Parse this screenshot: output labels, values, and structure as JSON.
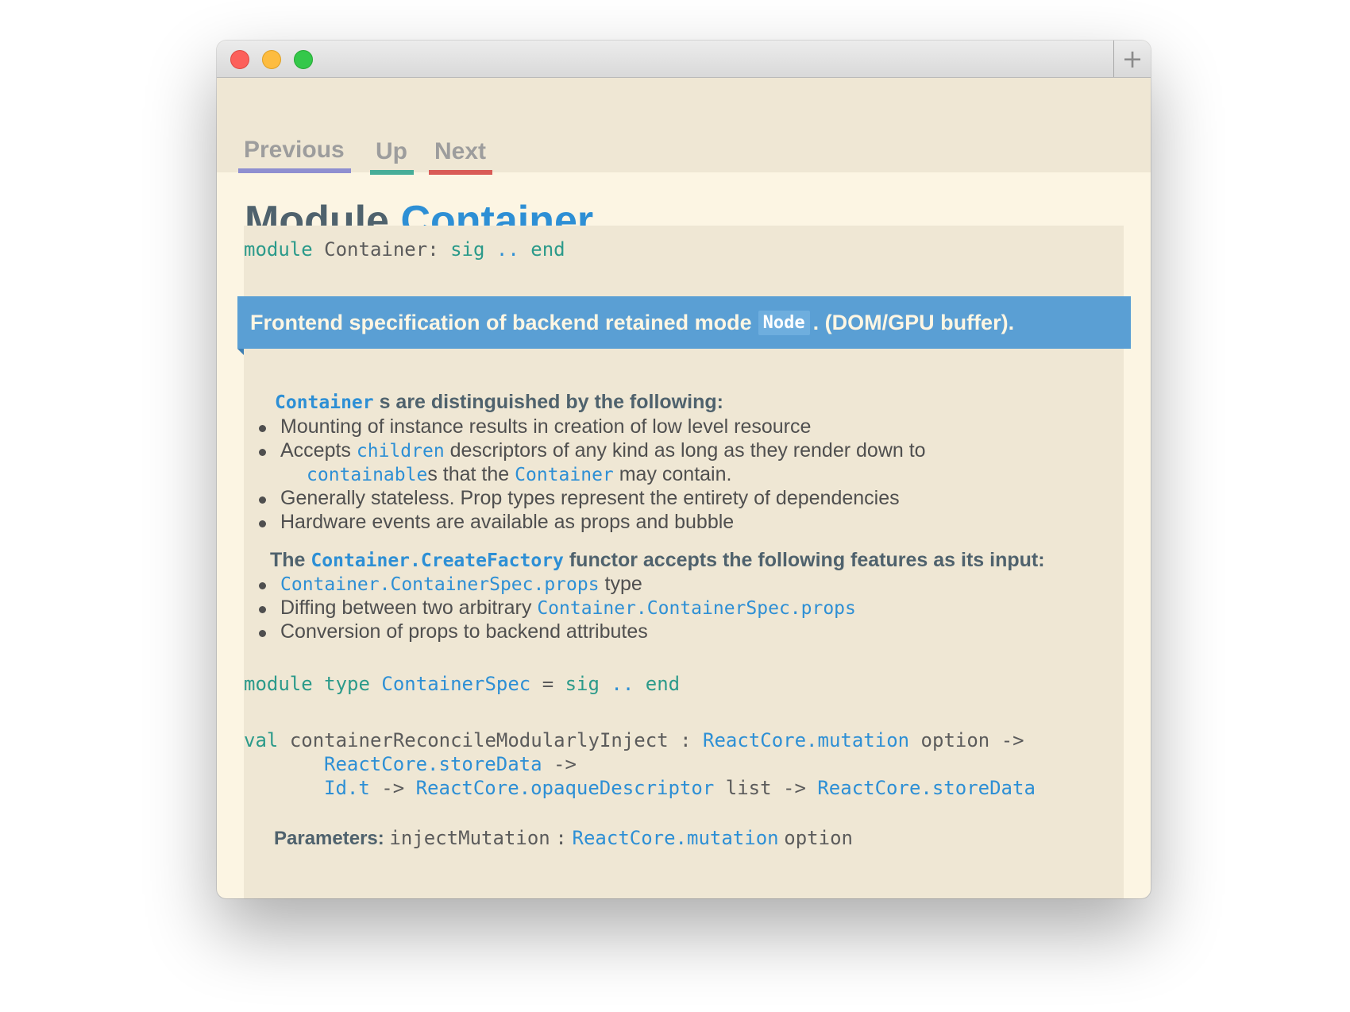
{
  "window": {
    "new_tab_symbol": "+"
  },
  "nav": {
    "previous": "Previous",
    "up": "Up",
    "next": "Next"
  },
  "title": {
    "prefix": "Module",
    "name": "Container"
  },
  "signature": {
    "kw_module": "module",
    "name": "Container:",
    "kw_sig": "sig",
    "dots": "..",
    "kw_end": "end"
  },
  "banner": {
    "text_before": "Frontend specification of backend retained mode",
    "code": "Node",
    "text_after": ". (DOM/GPU buffer)."
  },
  "section1": {
    "heading_code": "Container",
    "heading_text": "s are distinguished by the following:",
    "bullets": {
      "b1": "Mounting of instance results in creation of low level resource",
      "b2_pre": "Accepts",
      "b2_code": "children",
      "b2_post": "descriptors of any kind as long as they render down to",
      "b2_cont_code1": "containable",
      "b2_cont_mid": "s that the",
      "b2_cont_code2": "Container",
      "b2_cont_post": "may contain.",
      "b3": "Generally stateless. Prop types represent the entirety of dependencies",
      "b4": "Hardware events are available as props and bubble"
    }
  },
  "section2": {
    "heading_pre": "The",
    "heading_code": "Container.CreateFactory",
    "heading_post": "functor accepts the following features as its input:",
    "bullets": {
      "b1_code": "Container.ContainerSpec.props",
      "b1_post": "type",
      "b2_pre": "Diffing between two arbitrary",
      "b2_code": "Container.ContainerSpec.props",
      "b3": "Conversion of props to backend attributes"
    }
  },
  "module_type": {
    "kw_module": "module",
    "kw_type": "type",
    "name": "ContainerSpec",
    "eq": "=",
    "kw_sig": "sig",
    "dots": "..",
    "kw_end": "end"
  },
  "val_decl": {
    "kw_val": "val",
    "name": "containerReconcileModularlyInject",
    "colon": ":",
    "t1": "ReactCore.mutation",
    "t1_post": "option ->",
    "t2": "ReactCore.storeData",
    "t2_post": "->",
    "t3": "Id.t",
    "arrow1": "->",
    "t4": "ReactCore.opaqueDescriptor",
    "t4_post": "list ->",
    "t5": "ReactCore.storeData"
  },
  "params": {
    "label": "Parameters:",
    "name": "injectMutation",
    "colon": ":",
    "type": "ReactCore.mutation",
    "type_post": "option"
  }
}
